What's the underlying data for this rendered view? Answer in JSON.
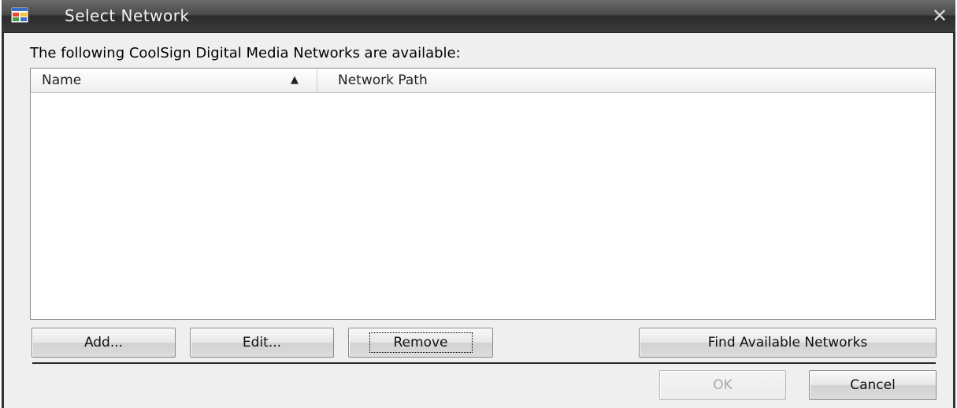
{
  "window": {
    "title": "Select Network",
    "close_glyph": "✕"
  },
  "prompt": "The following CoolSign Digital Media Networks are available:",
  "list": {
    "columns": [
      {
        "label": "Name",
        "sort": "ascending"
      },
      {
        "label": "Network Path"
      }
    ],
    "sort_glyph": "▲",
    "rows": []
  },
  "buttons": {
    "add": "Add...",
    "edit": "Edit...",
    "remove": "Remove",
    "find": "Find Available Networks",
    "ok": "OK",
    "cancel": "Cancel"
  },
  "icons": {
    "app": "app-window-icon",
    "close": "close-icon",
    "sort": "sort-ascending-icon"
  }
}
